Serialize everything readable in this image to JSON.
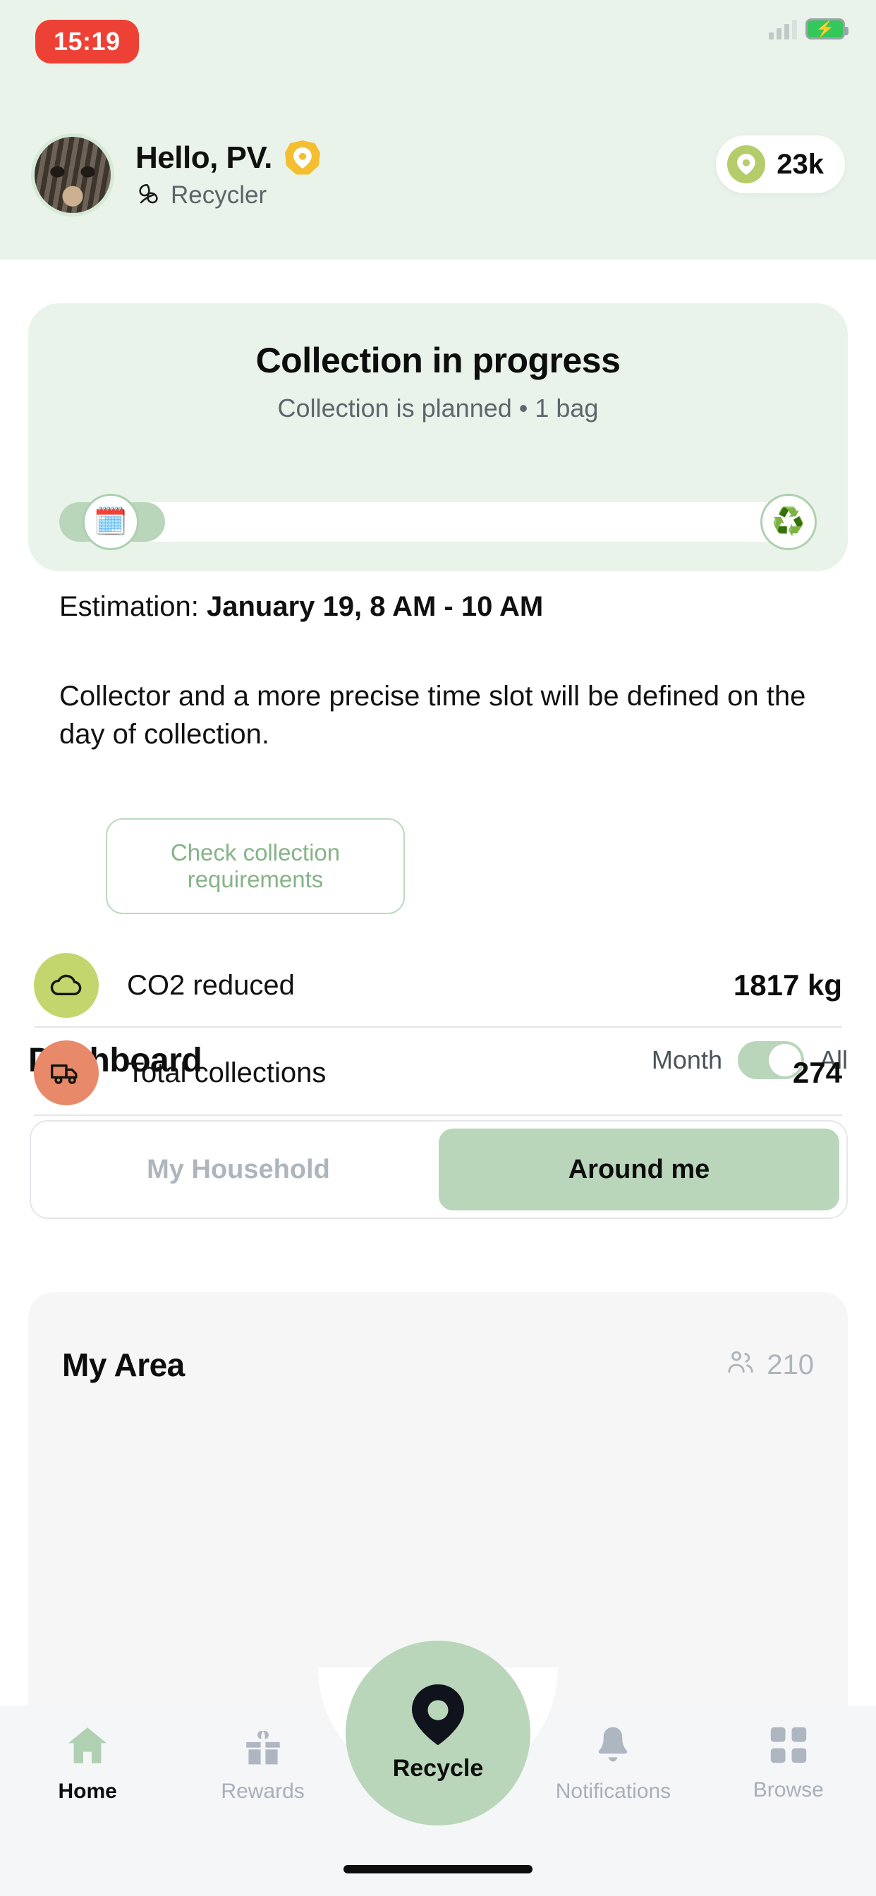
{
  "status_bar": {
    "time": "15:19",
    "clock_pill_color": "#ee4136",
    "battery_icon": "battery-charging-icon",
    "signal_icon": "signal-bars-icon"
  },
  "header": {
    "avatar_icon": "cat-avatar",
    "greeting": "Hello, PV.",
    "badge_icon": "leaf-pin-badge-icon",
    "role_icon": "leaf-icon",
    "role": "Recycler",
    "points": {
      "coin_icon": "leaf-pin-coin-icon",
      "value": "23k"
    },
    "background_color": "#e9f3ea"
  },
  "collection_card": {
    "title": "Collection in progress",
    "subtitle": "Collection is planned • 1 bag",
    "progress": {
      "start_icon": "calendar-emoji",
      "end_icon": "recycle-emoji",
      "fill_percent": 14
    },
    "estimation_label": "Estimation: ",
    "estimation_value": "January 19, 8 AM - 10 AM",
    "body": "Collector and a more precise time slot will be defined on the day of collection.",
    "requirements_button": "Check collection requirements",
    "background_color": "#e9f3ea"
  },
  "dashboard": {
    "title": "Dashboard",
    "range_toggle": {
      "left_label": "Month",
      "right_label": "All",
      "selected": "All"
    },
    "segments": [
      {
        "label": "My Household",
        "active": false
      },
      {
        "label": "Around me",
        "active": true
      }
    ]
  },
  "area_card": {
    "title": "My Area",
    "members_icon": "people-icon",
    "members_count": "210",
    "stats": [
      {
        "icon": "cloud-icon",
        "icon_color": "#c3d66d",
        "label": "CO2 reduced",
        "value": "1817 kg"
      },
      {
        "icon": "truck-icon",
        "icon_color": "#e8896a",
        "label": "Total collections",
        "value": "274"
      }
    ]
  },
  "bottom_nav": {
    "items": [
      {
        "label": "Home",
        "icon": "home-icon",
        "active": true
      },
      {
        "label": "Rewards",
        "icon": "gift-icon",
        "active": false
      },
      {
        "label": "Notifications",
        "icon": "bell-icon",
        "active": false
      },
      {
        "label": "Browse",
        "icon": "grid-icon",
        "active": false
      }
    ],
    "fab": {
      "label": "Recycle",
      "icon": "leaf-pin-icon",
      "color": "#b9d6ba"
    }
  }
}
